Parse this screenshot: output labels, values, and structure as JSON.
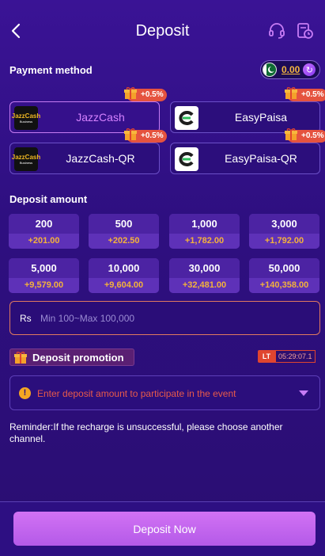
{
  "header": {
    "title": "Deposit",
    "back_icon": "chevron-left-icon",
    "support_icon": "headset-icon",
    "history_icon": "clock-document-icon"
  },
  "payment_method": {
    "label": "Payment method",
    "balance": {
      "amount": "0.00",
      "flag_icon": "pakistan-flag-icon",
      "refresh_icon": "refresh-icon"
    },
    "options": [
      {
        "name": "JazzCash",
        "bonus": "+0.5%",
        "selected": true,
        "logo_text": "JazzCash",
        "logo_sub": "Business"
      },
      {
        "name": "EasyPaisa",
        "bonus": "+0.5%",
        "selected": false
      },
      {
        "name": "JazzCash-QR",
        "bonus": "+0.5%",
        "selected": false,
        "logo_text": "JazzCash",
        "logo_sub": "Business"
      },
      {
        "name": "EasyPaisa-QR",
        "bonus": "+0.5%",
        "selected": false
      }
    ]
  },
  "deposit_amount": {
    "label": "Deposit amount",
    "amounts": [
      {
        "value": "200",
        "bonus": "+201.00"
      },
      {
        "value": "500",
        "bonus": "+202.50"
      },
      {
        "value": "1,000",
        "bonus": "+1,782.00"
      },
      {
        "value": "3,000",
        "bonus": "+1,792.00"
      },
      {
        "value": "5,000",
        "bonus": "+9,579.00"
      },
      {
        "value": "10,000",
        "bonus": "+9,604.00"
      },
      {
        "value": "30,000",
        "bonus": "+32,481.00"
      },
      {
        "value": "50,000",
        "bonus": "+140,358.00"
      }
    ],
    "currency": "Rs",
    "input_placeholder": "Min 100~Max 100,000",
    "input_value": ""
  },
  "promotion": {
    "label": "Deposit promotion",
    "lt_badge": "LT",
    "timer": "05:29:07.1",
    "event_text": "Enter deposit amount to participate in the event"
  },
  "reminder": "Reminder:If the recharge is unsuccessful, please choose another channel.",
  "footer": {
    "deposit_button": "Deposit Now"
  },
  "colors": {
    "accent": "#d272f4",
    "bonus": "#f4b23b",
    "badge": "#e5533f",
    "background": "#2e0f80"
  }
}
